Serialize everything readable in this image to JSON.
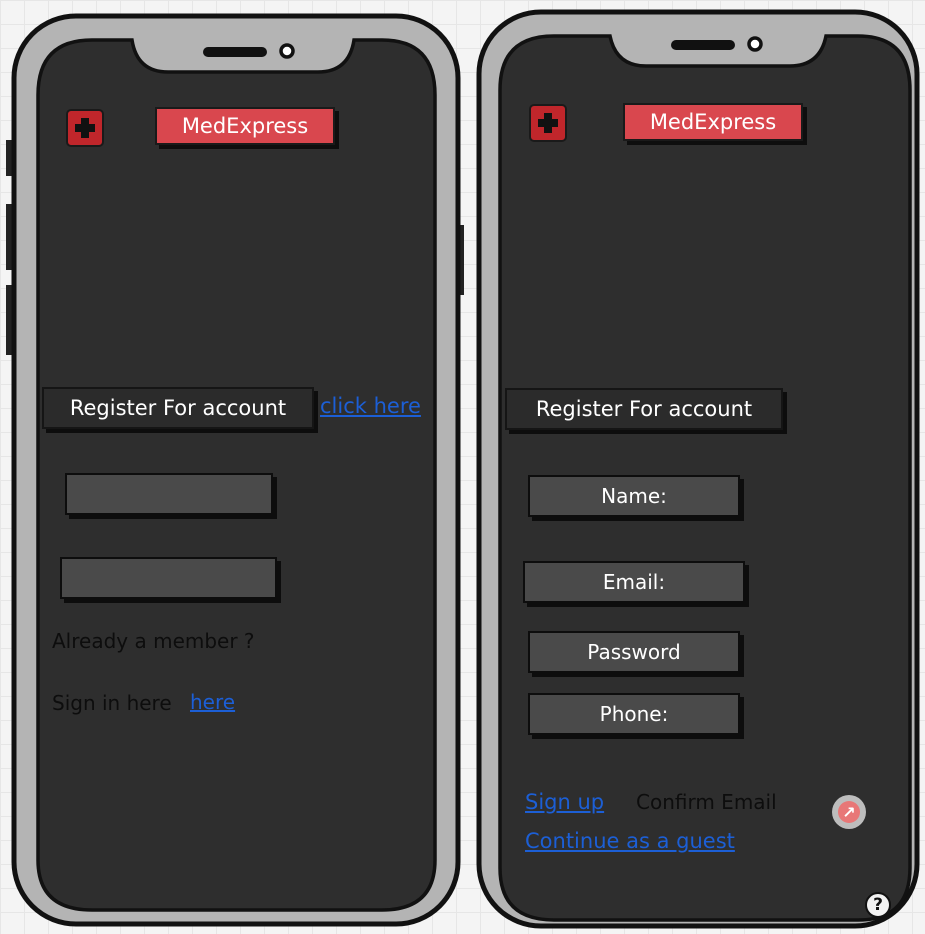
{
  "brand": {
    "name": "MedExpress",
    "accent_color": "#d9474e",
    "logo_icon": "medical-cross-icon"
  },
  "screen_left": {
    "heading": "Register For account",
    "register_link": "click here",
    "field_1": {
      "value": ""
    },
    "field_2": {
      "value": ""
    },
    "member_text": "Already a member ?",
    "signin_text": "Sign in here",
    "signin_link": "here"
  },
  "screen_right": {
    "heading": "Register For account",
    "fields": {
      "name": "Name:",
      "email": "Email:",
      "password": "Password",
      "phone": "Phone:"
    },
    "signup_link": "Sign up",
    "confirm_email": "Confirm Email",
    "guest_link": "Continue as a guest",
    "help_symbol": "?",
    "share_icon": "arrow-up-right-icon",
    "help_icon": "question-mark-icon"
  }
}
